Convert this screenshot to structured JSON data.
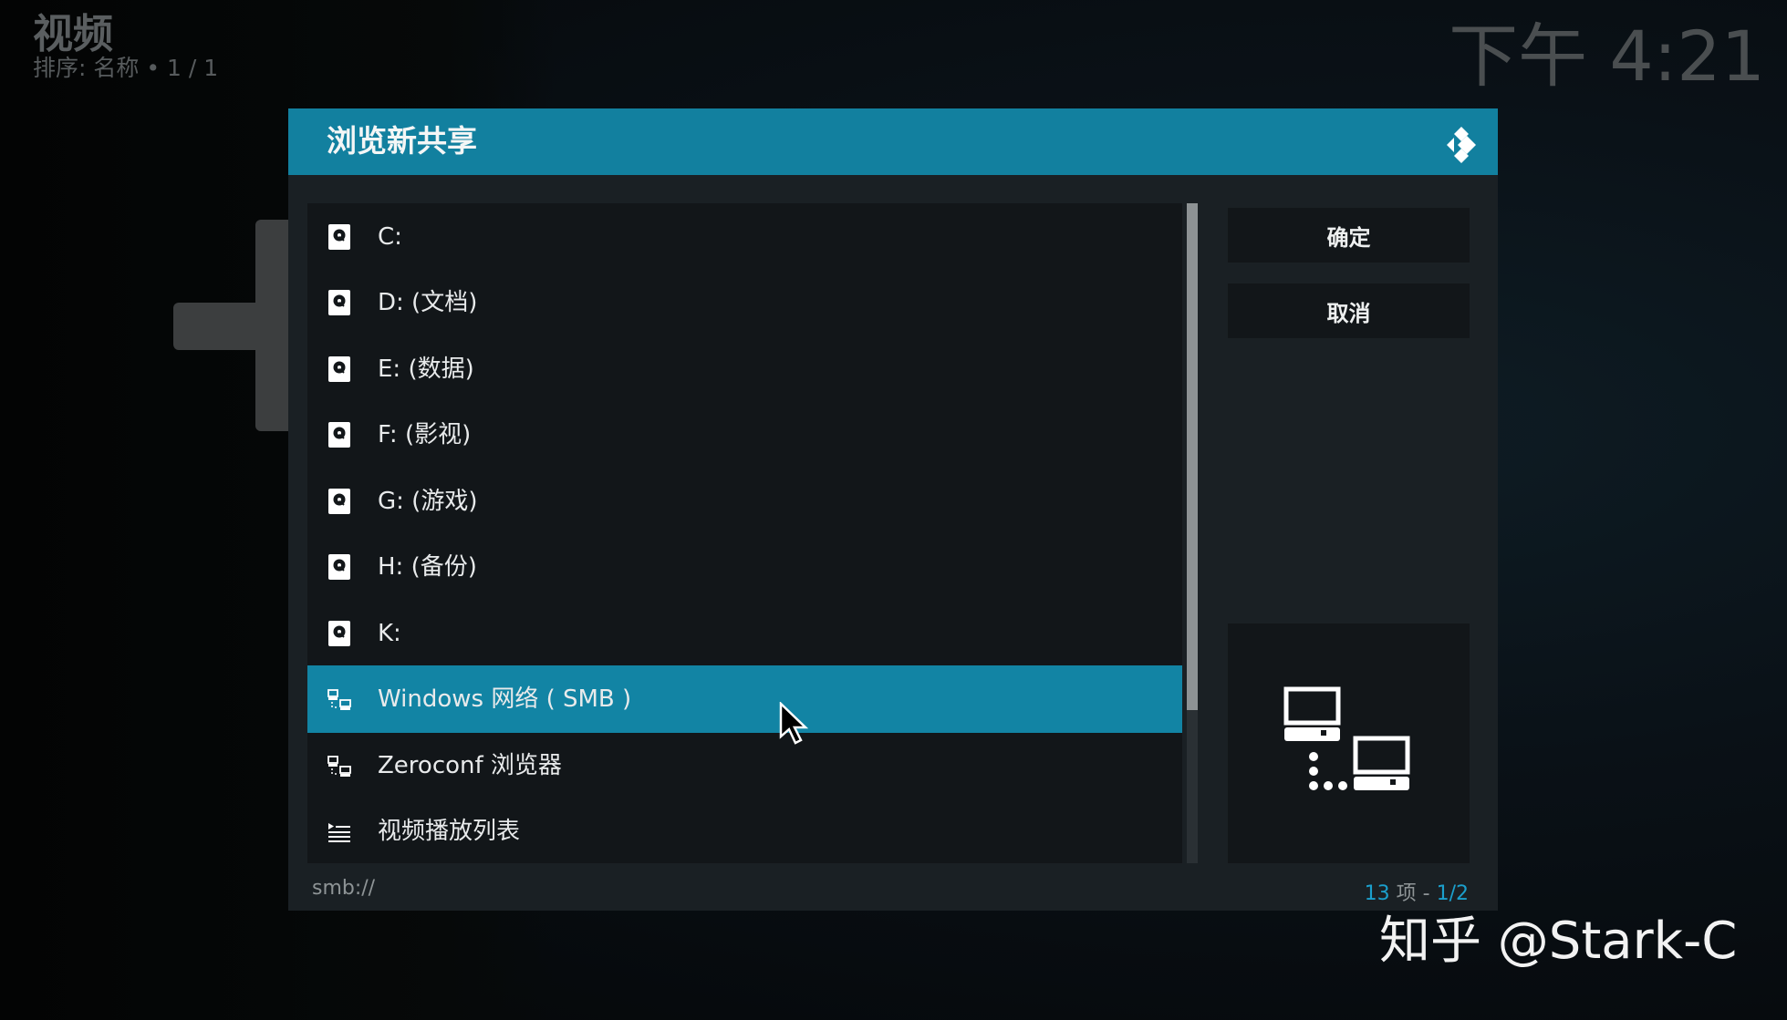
{
  "header": {
    "title": "视频",
    "sort_line": "排序: 名称  •  1 / 1",
    "clock": "下午 4:21"
  },
  "dialog": {
    "title": "浏览新共享",
    "items": [
      {
        "label": "C:",
        "icon": "hard-drive-icon"
      },
      {
        "label": "D: (文档)",
        "icon": "hard-drive-icon"
      },
      {
        "label": "E: (数据)",
        "icon": "hard-drive-icon"
      },
      {
        "label": "F: (影视)",
        "icon": "hard-drive-icon"
      },
      {
        "label": "G: (游戏)",
        "icon": "hard-drive-icon"
      },
      {
        "label": "H: (备份)",
        "icon": "hard-drive-icon"
      },
      {
        "label": "K:",
        "icon": "hard-drive-icon"
      },
      {
        "label": "Windows 网络 ( SMB )",
        "icon": "network-icon",
        "selected": true
      },
      {
        "label": "Zeroconf 浏览器",
        "icon": "network-icon"
      },
      {
        "label": "视频播放列表",
        "icon": "playlist-icon"
      }
    ],
    "ok_label": "确定",
    "cancel_label": "取消",
    "path": "smb://",
    "count": {
      "total": "13",
      "unit": " 项 - ",
      "page": "1/2"
    }
  },
  "watermark": "知乎 @Stark-C",
  "colors": {
    "accent": "#12809f",
    "selected": "#1284a4",
    "count_accent": "#1b9fcc"
  }
}
